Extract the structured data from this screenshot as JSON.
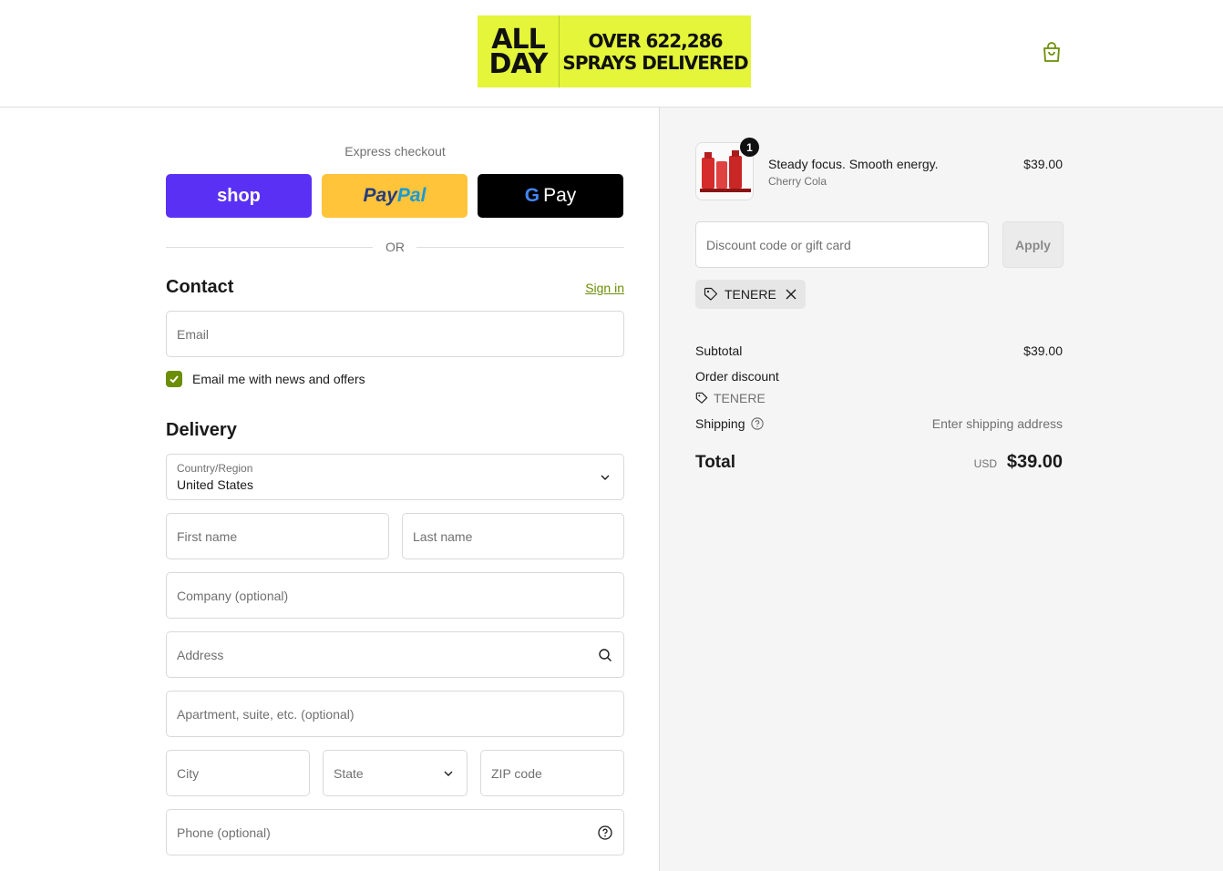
{
  "header": {
    "logo_line1": "ALL",
    "logo_line2": "DAY",
    "banner_line1": "OVER 622,286",
    "banner_line2": "SPRAYS DELIVERED",
    "cart_icon": "shopping-bag-icon",
    "accent_color": "#e4f53a"
  },
  "express": {
    "label": "Express checkout",
    "shop_label": "shop",
    "paypal_part1": "Pay",
    "paypal_part2": "Pal",
    "gpay_g": "G",
    "gpay_label": "Pay",
    "or_label": "OR"
  },
  "contact": {
    "title": "Contact",
    "sign_in": "Sign in",
    "email_placeholder": "Email",
    "newsletter_label": "Email me with news and offers",
    "newsletter_checked": true
  },
  "delivery": {
    "title": "Delivery",
    "country_label": "Country/Region",
    "country_value": "United States",
    "first_name_placeholder": "First name",
    "last_name_placeholder": "Last name",
    "company_placeholder": "Company (optional)",
    "address_placeholder": "Address",
    "apartment_placeholder": "Apartment, suite, etc. (optional)",
    "city_placeholder": "City",
    "state_placeholder": "State",
    "zip_placeholder": "ZIP code",
    "phone_placeholder": "Phone (optional)"
  },
  "summary": {
    "product": {
      "name": "Steady focus. Smooth energy.",
      "variant": "Cherry Cola",
      "price": "$39.00",
      "quantity": "1"
    },
    "discount_placeholder": "Discount code or gift card",
    "apply_label": "Apply",
    "applied_code": "TENERE",
    "subtotal_label": "Subtotal",
    "subtotal_value": "$39.00",
    "order_discount_label": "Order discount",
    "order_discount_code": "TENERE",
    "shipping_label": "Shipping",
    "shipping_value": "Enter shipping address",
    "total_label": "Total",
    "total_currency": "USD",
    "total_value": "$39.00"
  },
  "colors": {
    "shop_pay": "#5a31f4",
    "paypal": "#ffc439",
    "gpay": "#000000",
    "link_green": "#6b8e06"
  }
}
